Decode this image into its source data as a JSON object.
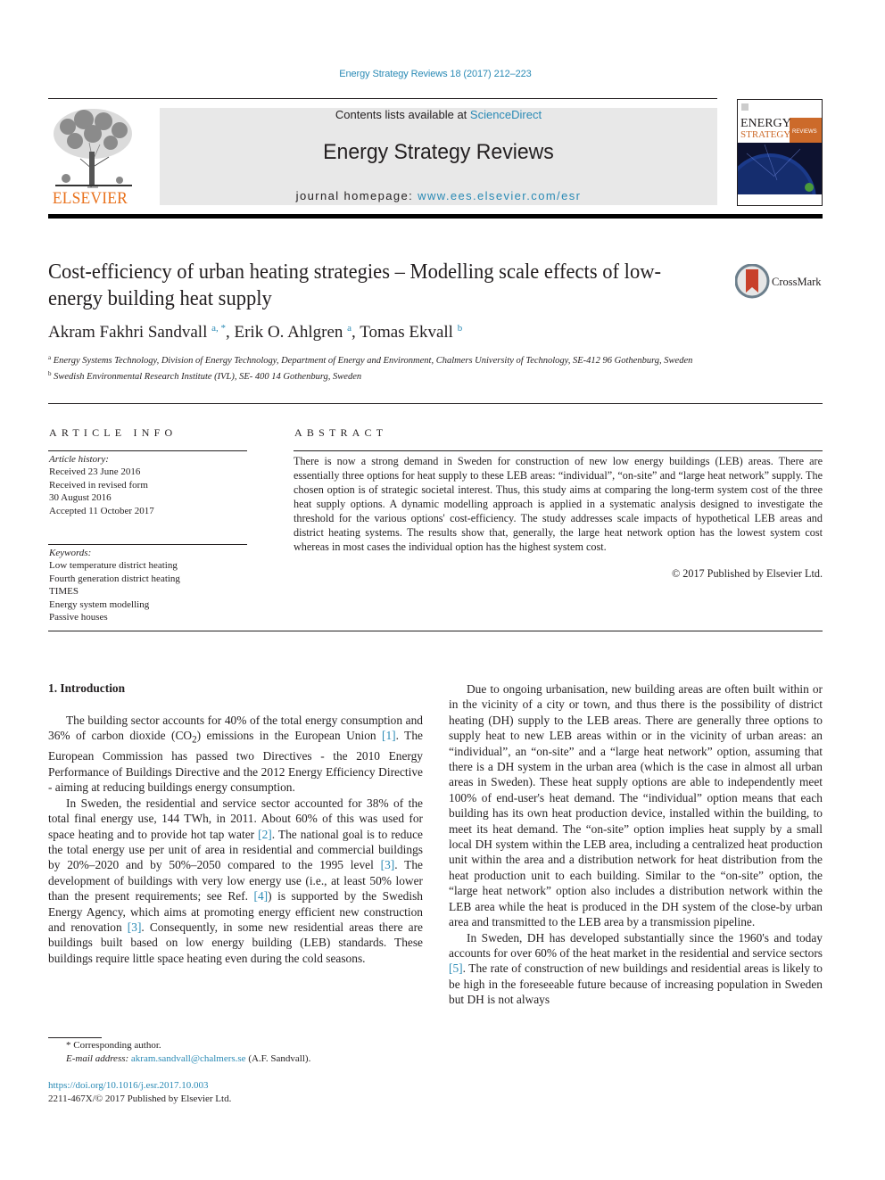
{
  "header": {
    "citation": "Energy Strategy Reviews 18 (2017) 212–223",
    "contents_prefix": "Contents lists available at ",
    "contents_link": "ScienceDirect",
    "journal_name": "Energy Strategy Reviews",
    "homepage_prefix": "journal homepage: ",
    "homepage_link": "www.ees.elsevier.com/esr",
    "publisher_logo_text": "ELSEVIER",
    "cover": {
      "title_line1": "ENERGY",
      "title_line2": "STRATEGY",
      "title_tag": "REVIEWS"
    },
    "colors": {
      "link": "#2a8ab5",
      "elsevier_orange": "#e9711c",
      "banner_bg": "#e8e8e8"
    }
  },
  "article": {
    "title": "Cost-efficiency of urban heating strategies – Modelling scale effects of low-energy building heat supply",
    "crossmark_label": "CrossMark",
    "authors": [
      {
        "name": "Akram Fakhri Sandvall",
        "sup": "a, *"
      },
      {
        "name": "Erik O. Ahlgren",
        "sup": "a"
      },
      {
        "name": "Tomas Ekvall",
        "sup": "b"
      }
    ],
    "affiliations": [
      {
        "mark": "a",
        "text": "Energy Systems Technology, Division of Energy Technology, Department of Energy and Environment, Chalmers University of Technology, SE-412 96 Gothenburg, Sweden"
      },
      {
        "mark": "b",
        "text": "Swedish Environmental Research Institute (IVL), SE- 400 14 Gothenburg, Sweden"
      }
    ]
  },
  "article_info": {
    "heading": "ARTICLE INFO",
    "history_label": "Article history:",
    "history": [
      "Received 23 June 2016",
      "Received in revised form",
      "30 August 2016",
      "Accepted 11 October 2017"
    ],
    "keywords_label": "Keywords:",
    "keywords": [
      "Low temperature district heating",
      "Fourth generation district heating",
      "TIMES",
      "Energy system modelling",
      "Passive houses"
    ]
  },
  "abstract": {
    "heading": "ABSTRACT",
    "text": "There is now a strong demand in Sweden for construction of new low energy buildings (LEB) areas. There are essentially three options for heat supply to these LEB areas: “individual”, “on-site” and “large heat network” supply. The chosen option is of strategic societal interest. Thus, this study aims at comparing the long-term system cost of the three heat supply options. A dynamic modelling approach is applied in a systematic analysis designed to investigate the threshold for the various options' cost-efficiency. The study addresses scale impacts of hypothetical LEB areas and district heating systems. The results show that, generally, the large heat network option has the lowest system cost whereas in most cases the individual option has the highest system cost.",
    "copyright": "© 2017 Published by Elsevier Ltd."
  },
  "body": {
    "section1_heading": "1.  Introduction",
    "left": {
      "p1_a": "The building sector accounts for 40% of the total energy consumption and 36% of carbon dioxide (CO",
      "p1_sub": "2",
      "p1_b": ") emissions in the European Union ",
      "p1_ref1": "[1]",
      "p1_c": ". The European Commission has passed two Directives - the 2010 Energy Performance of Buildings Directive and the 2012 Energy Efficiency Directive - aiming at reducing buildings energy consumption.",
      "p2_a": "In Sweden, the residential and service sector accounted for 38% of the total final energy use, 144 TWh, in 2011. About 60% of this was used for space heating and to provide hot tap water ",
      "p2_ref2": "[2]",
      "p2_b": ". The national goal is to reduce the total energy use per unit of area in residential and commercial buildings by 20%–2020 and by 50%–2050 compared to the 1995 level ",
      "p2_ref3": "[3]",
      "p2_c": ". The development of buildings with very low energy use (i.e., at least 50% lower than the present requirements; see Ref. ",
      "p2_ref4": "[4]",
      "p2_d": ") is supported by the Swedish Energy Agency, which aims at promoting energy efficient new construction and renovation ",
      "p2_ref3b": "[3]",
      "p2_e": ". Consequently, in some new residential areas there are buildings built based on low energy building (LEB) standards. These buildings require little space heating even during the cold seasons."
    },
    "right": {
      "p1": "Due to ongoing urbanisation, new building areas are often built within or in the vicinity of a city or town, and thus there is the possibility of district heating (DH) supply to the LEB areas. There are generally three options to supply heat to new LEB areas within or in the vicinity of urban areas: an “individual”, an “on-site” and a “large heat network” option, assuming that there is a DH system in the urban area (which is the case in almost all urban areas in Sweden). These heat supply options are able to independently meet 100% of end-user's heat demand. The “individual” option means that each building has its own heat production device, installed within the building, to meet its heat demand. The “on-site” option implies heat supply by a small local DH system within the LEB area, including a centralized heat production unit within the area and a distribution network for heat distribution from the heat production unit to each building. Similar to the “on-site” option, the “large heat network” option also includes a distribution network within the LEB area while the heat is produced in the DH system of the close-by urban area and transmitted to the LEB area by a transmission pipeline.",
      "p2_a": "In Sweden, DH has developed substantially since the 1960's and today accounts for over 60% of the heat market in the residential and service sectors ",
      "p2_ref5": "[5]",
      "p2_b": ". The rate of construction of new buildings and residential areas is likely to be high in the foreseeable future because of increasing population in Sweden but DH is not always"
    }
  },
  "footnotes": {
    "corresponding": "* Corresponding author.",
    "email_label": "E-mail address: ",
    "email": "akram.sandvall@chalmers.se",
    "email_suffix": " (A.F. Sandvall).",
    "doi": "https://doi.org/10.1016/j.esr.2017.10.003",
    "issn": "2211-467X/© 2017 Published by Elsevier Ltd."
  }
}
